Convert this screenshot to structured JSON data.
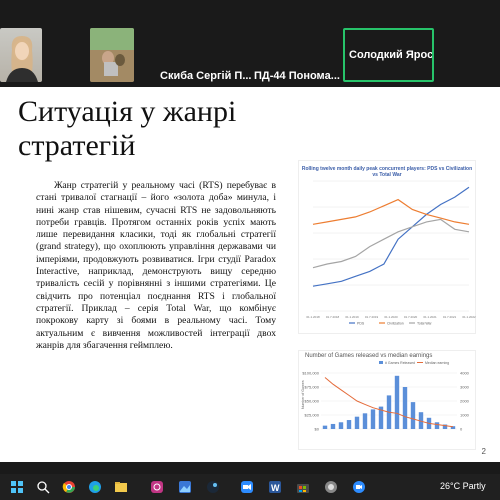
{
  "meeting": {
    "participants": [
      {
        "name": ""
      },
      {
        "name": "Скиба Сергій П..."
      },
      {
        "name": "ПД-44 Пономa..."
      },
      {
        "name": "Солодкий Ярос..."
      }
    ]
  },
  "slide": {
    "title": "Ситуація у жанрі стратегій",
    "body": "Жанр стратегій у реальному часі (RTS) перебуває в стані тривалої стагнації – його «золота доба» минула, і нині жанр став нішевим, сучасні RTS не задовольняють потреби гравців. Протягом останніх років успіх мають лише перевидання класики, тоді як глобальні стратегії (grand strategy), що охоплюють управління державами чи імперіями, продовжують розвиватися. Ігри студії Paradox Interactive, наприклад, демонструють вищу середню тривалість сесій у порівнянні з іншими стратегіями. Це свідчить про потенціал поєднання RTS і глобальної стратегії. Приклад – серія Total War, що комбінує покрокову карту зі боями в реальному часі. Тому актуальним є вивчення можливостей інтеграції двох жанрів для збагачення геймплею.",
    "page_number": "2"
  },
  "chart_data": [
    {
      "type": "line",
      "title": "Rolling twelve month daily peak concurrent players: PDS vs Civilization vs Total War",
      "x": [
        "01.1.2018",
        "01.7.2018",
        "01.1.2019",
        "01.7.2019",
        "01.1.2020",
        "01.7.2020",
        "01.1.2021",
        "01.7.2021",
        "01.1.2022"
      ],
      "series": [
        {
          "name": "PDS",
          "color": "#4472c4",
          "values": [
            20,
            22,
            24,
            28,
            32,
            38,
            58,
            68,
            78,
            86,
            92,
            100
          ]
        },
        {
          "name": "Civilization",
          "color": "#ed7d31",
          "values": [
            70,
            72,
            74,
            76,
            80,
            85,
            90,
            82,
            78,
            75,
            72,
            70
          ]
        },
        {
          "name": "Total War",
          "color": "#a5a5a5",
          "values": [
            35,
            38,
            40,
            44,
            52,
            58,
            64,
            68,
            72,
            74,
            66,
            64
          ]
        }
      ]
    },
    {
      "type": "bar",
      "title": "Number of Games released vs median earnings",
      "legend": [
        "# Games Released",
        "Median earning"
      ],
      "left_axis": [
        "$100,000",
        "$75,000",
        "$50,000",
        "$25,000",
        "$0"
      ],
      "right_axis": [
        "4000",
        "3000",
        "2000",
        "1000",
        "0"
      ],
      "ylabel_left": "Number of Games",
      "values": [
        6,
        9,
        12,
        16,
        22,
        28,
        35,
        40,
        60,
        95,
        75,
        48,
        30,
        20,
        12,
        8,
        5
      ]
    }
  ],
  "taskbar": {
    "icons": [
      "windows-icon",
      "search-icon",
      "chrome-icon",
      "edge-icon",
      "explorer-icon",
      "instagram-icon",
      "photos-icon",
      "steam-icon",
      "zoom-icon",
      "word-icon",
      "store-icon",
      "app-icon",
      "zoom-meeting-icon"
    ],
    "weather": "26°C Partly"
  }
}
